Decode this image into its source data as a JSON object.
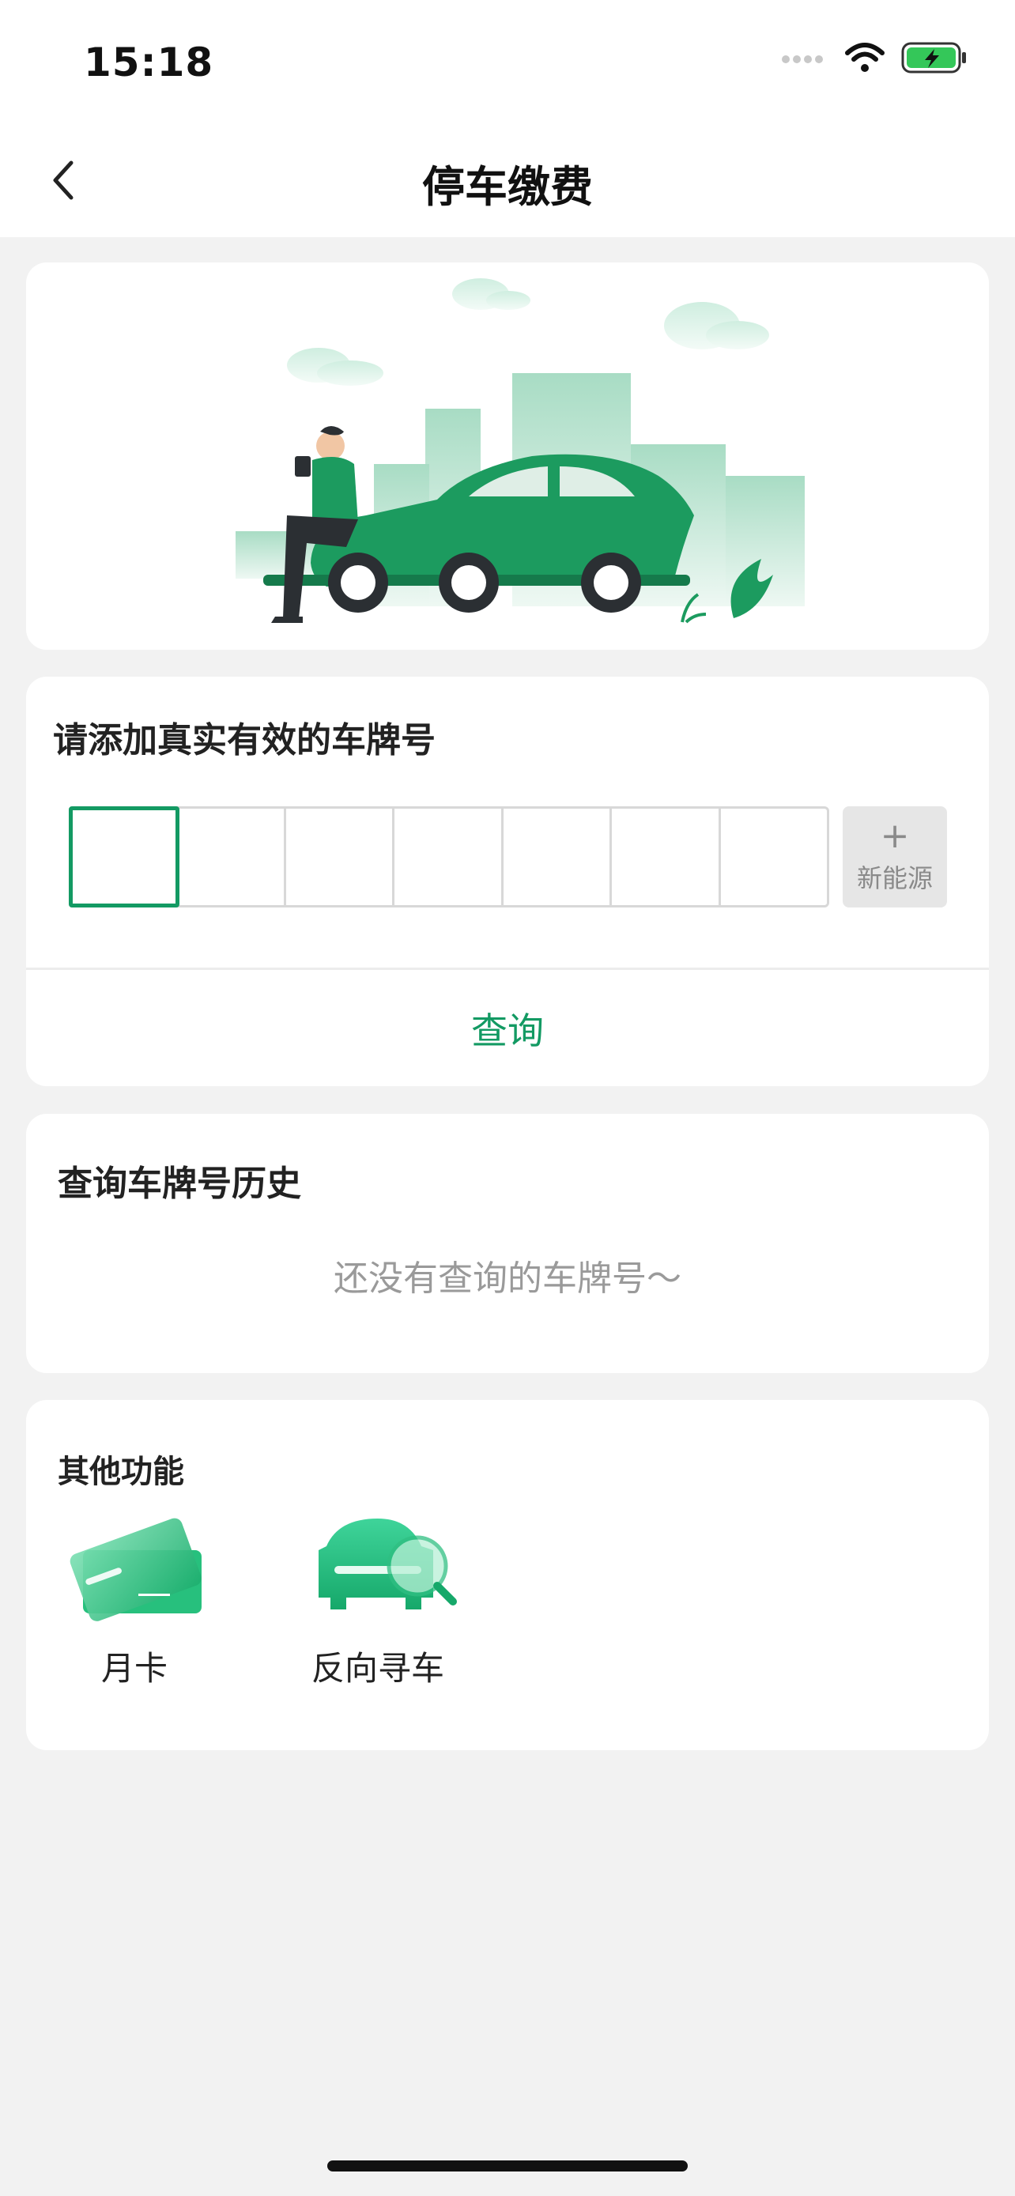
{
  "status": {
    "time": "15:18"
  },
  "nav": {
    "title": "停车缴费"
  },
  "plate": {
    "prompt": "请添加真实有效的车牌号",
    "new_energy_plus": "+",
    "new_energy_label": "新能源",
    "query_label": "查询"
  },
  "history": {
    "title": "查询车牌号历史",
    "empty_text": "还没有查询的车牌号～"
  },
  "other": {
    "title": "其他功能",
    "items": [
      {
        "label": "月卡",
        "icon": "monthly-card-icon"
      },
      {
        "label": "反向寻车",
        "icon": "reverse-car-search-icon"
      }
    ]
  },
  "colors": {
    "accent": "#139a63",
    "background": "#f2f2f2"
  }
}
